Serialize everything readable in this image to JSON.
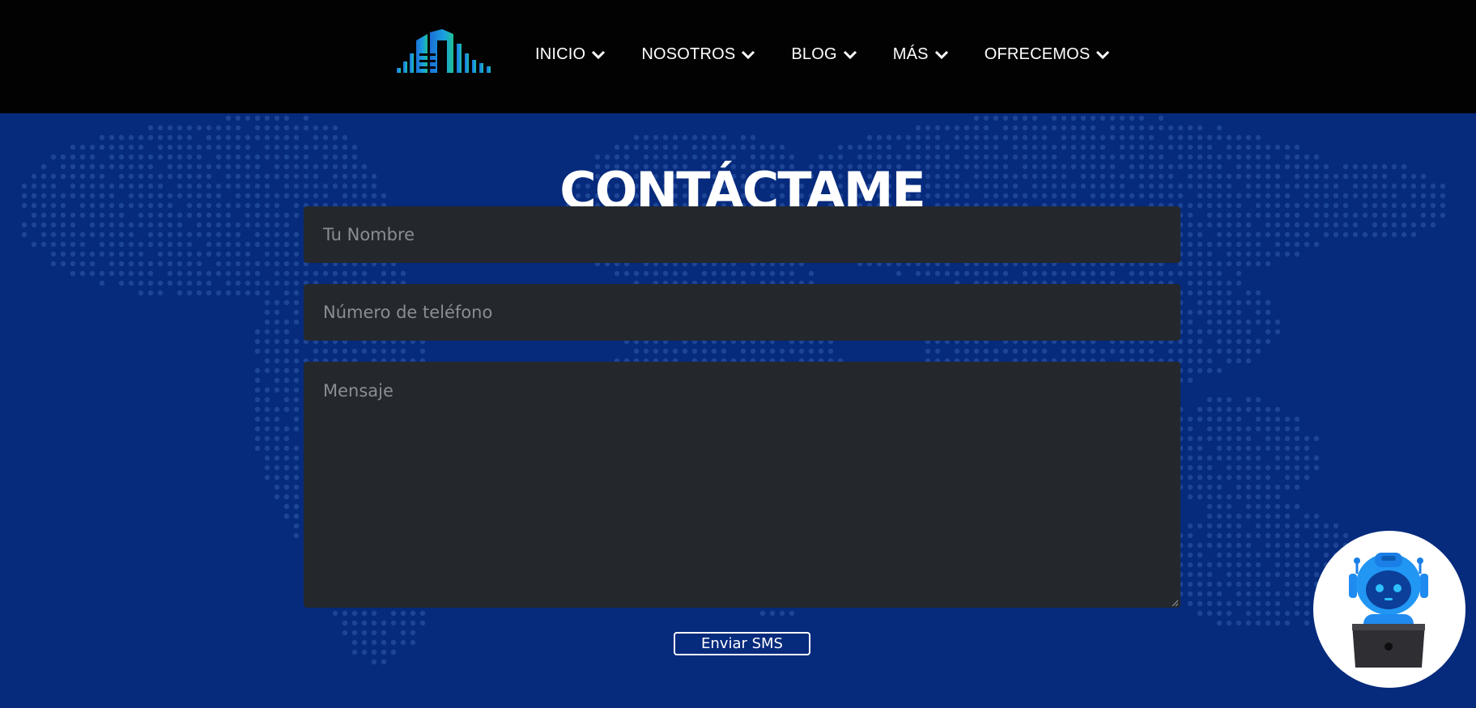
{
  "header": {
    "logo_icon": "building-bars-logo",
    "nav": [
      {
        "label": "INICIO"
      },
      {
        "label": "NOSOTROS"
      },
      {
        "label": "BLOG"
      },
      {
        "label": "MÁS"
      },
      {
        "label": "OFRECEMOS"
      }
    ]
  },
  "contact": {
    "title": "CONTÁCTAME",
    "name_placeholder": "Tu Nombre",
    "phone_placeholder": "Número de teléfono",
    "message_placeholder": "Mensaje",
    "submit_label": "Enviar SMS"
  },
  "chat_widget": {
    "icon": "robot-laptop-icon"
  },
  "colors": {
    "header_bg": "#020202",
    "page_bg": "#062a7c",
    "field_bg": "#24282d",
    "map_dots": "#1d4596"
  }
}
